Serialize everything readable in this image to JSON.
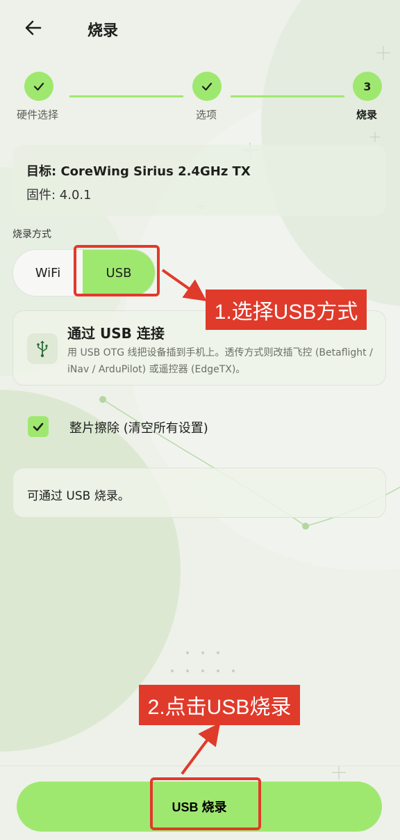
{
  "header": {
    "title": "烧录"
  },
  "stepper": {
    "steps": [
      {
        "label": "硬件选择",
        "marker": "✓",
        "state": "done"
      },
      {
        "label": "选项",
        "marker": "✓",
        "state": "done"
      },
      {
        "label": "烧录",
        "marker": "3",
        "state": "active"
      }
    ]
  },
  "info": {
    "target": "目标: CoreWing Sirius 2.4GHz TX",
    "firmware": "固件: 4.0.1"
  },
  "method": {
    "label": "烧录方式",
    "options": [
      "WiFi",
      "USB"
    ],
    "selected": "USB"
  },
  "usb_card": {
    "icon": "usb-icon",
    "title": "通过 USB 连接",
    "description": "用 USB OTG 线把设备插到手机上。透传方式则改插飞控 (Betaflight / iNav / ArduPilot) 或遥控器 (EdgeTX)。"
  },
  "full_erase": {
    "label": "整片擦除 (清空所有设置)",
    "checked": true
  },
  "status": {
    "text": "可通过 USB 烧录。"
  },
  "flash_button": {
    "label": "USB 烧录"
  },
  "annotations": {
    "callout1": "1.选择USB方式",
    "callout2": "2.点击USB烧录"
  },
  "colors": {
    "accent": "#9fe870",
    "annotation": "#e03a2b"
  }
}
